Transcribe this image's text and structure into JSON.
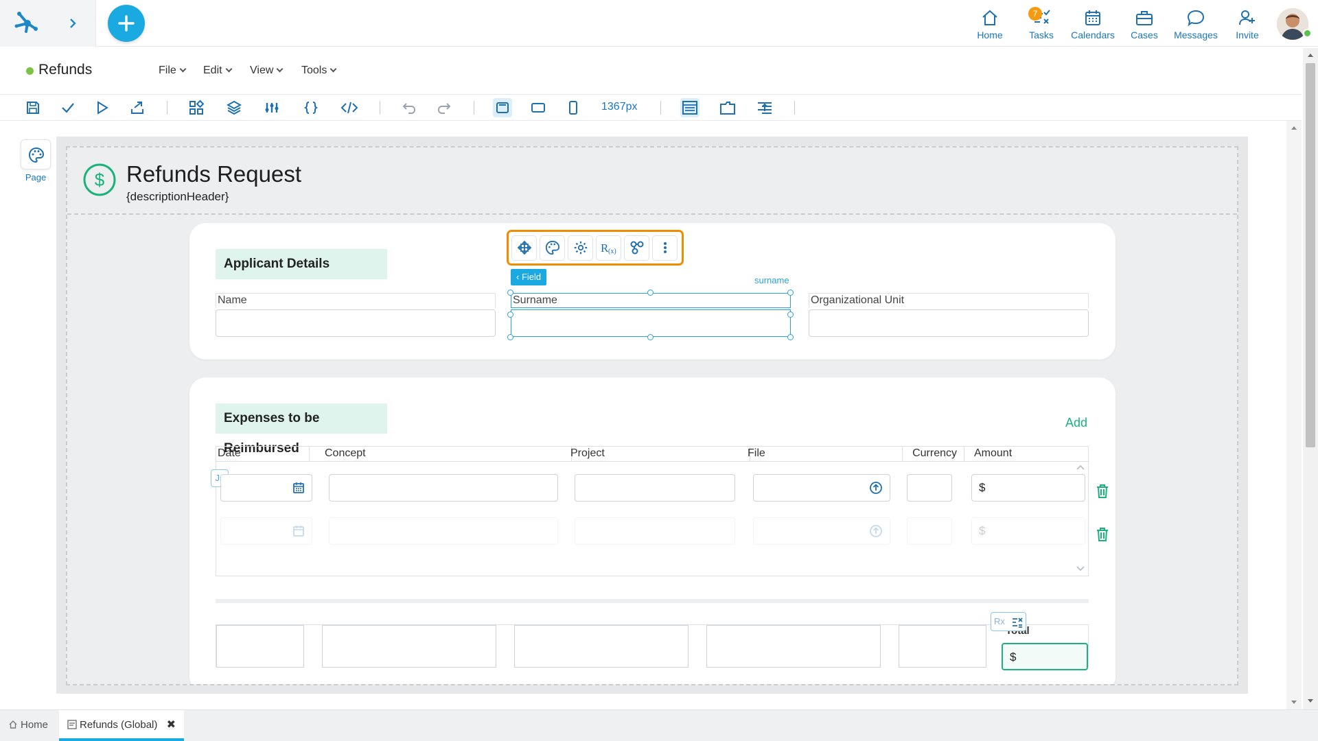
{
  "nav": {
    "home": "Home",
    "tasks": "Tasks",
    "tasks_badge": "7",
    "calendars": "Calendars",
    "cases": "Cases",
    "messages": "Messages",
    "invite": "Invite"
  },
  "document": {
    "title": "Refunds",
    "menus": [
      "File",
      "Edit",
      "View",
      "Tools"
    ]
  },
  "toolbar": {
    "width_readout": "1367px"
  },
  "palette": {
    "page_label": "Page"
  },
  "form": {
    "title": "Refunds Request",
    "description": "{descriptionHeader}",
    "applicant": {
      "section_title": "Applicant Details",
      "fields": [
        "Name",
        "Surname",
        "Organizational Unit"
      ],
      "selected_field_tag": "Field",
      "selected_field_id": "surname"
    },
    "expenses": {
      "section_title": "Expenses to be Reimbursed",
      "add_label": "Add",
      "columns": [
        "Date",
        "Concept",
        "Project",
        "File",
        "Currency",
        "Amount"
      ],
      "currency_symbol": "$",
      "js_badge": "Js"
    },
    "totals": {
      "label": "Total",
      "currency_symbol": "$",
      "rx_badge": "Rx"
    }
  },
  "tabs": {
    "home": "Home",
    "active": "Refunds (Global)"
  },
  "colors": {
    "accent": "#1ba9e1",
    "selection_toolbar": "#f08c00",
    "section_bg": "#def4ec",
    "success": "#1ab27a"
  }
}
